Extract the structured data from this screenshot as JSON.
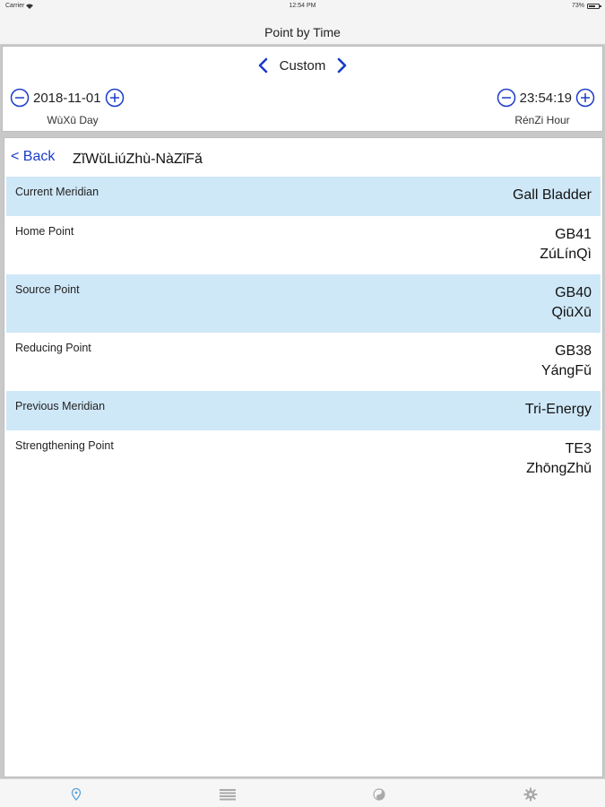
{
  "status_bar": {
    "carrier": "Carrier",
    "time": "12:54 PM",
    "battery": "73%",
    "battery_level": 0.73
  },
  "nav": {
    "title": "Point by Time"
  },
  "mode": {
    "label": "Custom"
  },
  "date": {
    "value": "2018-11-01",
    "sublabel": "WùXū Day"
  },
  "time": {
    "value": "23:54:19",
    "sublabel": "RénZi Hour"
  },
  "detail": {
    "back_label": "< Back",
    "title": "ZĭWǔLiúZhù-NàZǐFǎ",
    "rows": [
      {
        "label": "Current Meridian",
        "value": "Gall Bladder",
        "value2": ""
      },
      {
        "label": "Home Point",
        "value": "GB41",
        "value2": "ZúLínQì"
      },
      {
        "label": "Source Point",
        "value": "GB40",
        "value2": "QiūXū"
      },
      {
        "label": "Reducing Point",
        "value": "GB38",
        "value2": "YángFǔ"
      },
      {
        "label": "Previous Meridian",
        "value": "Tri-Energy",
        "value2": ""
      },
      {
        "label": "Strengthening Point",
        "value": "TE3",
        "value2": "ZhōngZhǔ"
      }
    ]
  },
  "tabs": [
    "location-pin-icon",
    "list-icon",
    "yin-yang-icon",
    "gear-icon"
  ],
  "colors": {
    "accent": "#1a3cc8",
    "highlight_row": "#cfe8f8",
    "tab_active": "#5aa0d8",
    "tab_inactive": "#a9a9a9"
  }
}
